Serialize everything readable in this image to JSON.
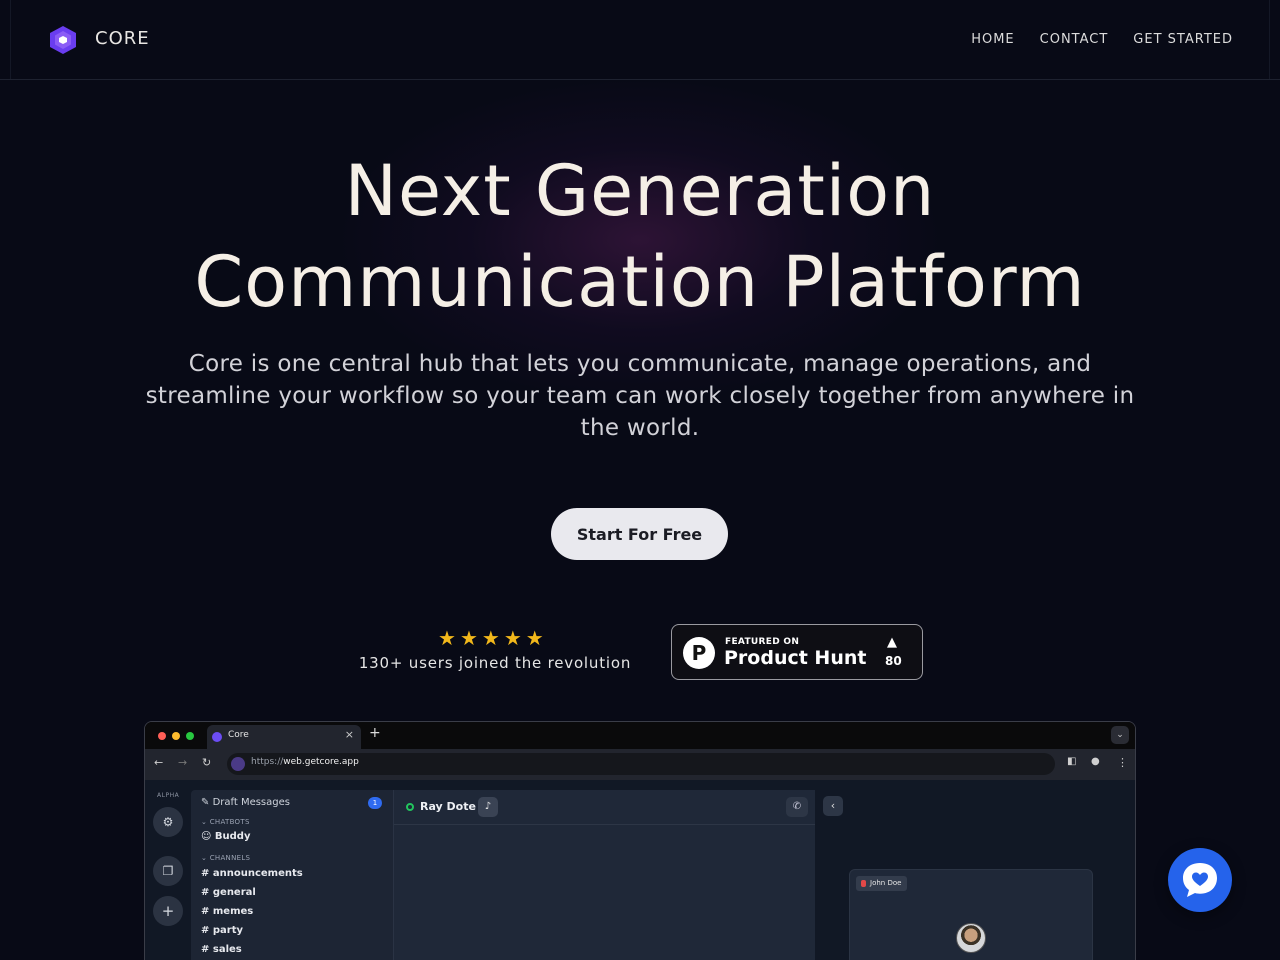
{
  "nav": {
    "brand": "CORE",
    "links": [
      "HOME",
      "CONTACT",
      "GET STARTED"
    ]
  },
  "hero": {
    "title_line1": "Next Generation",
    "title_line2": "Communication Platform",
    "subtitle": "Core is one central hub that lets you communicate, manage operations, and streamline your workflow so your team can work closely together from anywhere in the world.",
    "cta": "Start For Free"
  },
  "social_proof": {
    "stars": 5,
    "users_text": "130+ users joined the revolution"
  },
  "product_hunt": {
    "featured_label": "FEATURED ON",
    "name": "Product Hunt",
    "logo_letter": "P",
    "upvote_arrow": "▲",
    "upvotes": "80"
  },
  "browser": {
    "tab_title": "Core",
    "url_prefix": "https://",
    "url_host": "web.getcore.app",
    "app": {
      "workspace_label": "ALPHA",
      "draft_messages": "Draft Messages",
      "draft_count": "1",
      "chatbots_heading": "CHATBOTS",
      "chatbots": [
        "Buddy"
      ],
      "channels_heading": "CHANNELS",
      "channels": [
        "announcements",
        "general",
        "memes",
        "party",
        "sales"
      ],
      "chat_name": "Ray Dote",
      "video_participant": "John Doe"
    }
  },
  "colors": {
    "background": "#080a16",
    "accent": "#6c4df5",
    "cta_bg": "#e9e9ee",
    "star": "#f2b81b",
    "fab": "#2563eb",
    "online": "#22c55e"
  },
  "icons": {
    "logo": "hexagon-logo-icon",
    "fab": "chat-heart-icon"
  }
}
